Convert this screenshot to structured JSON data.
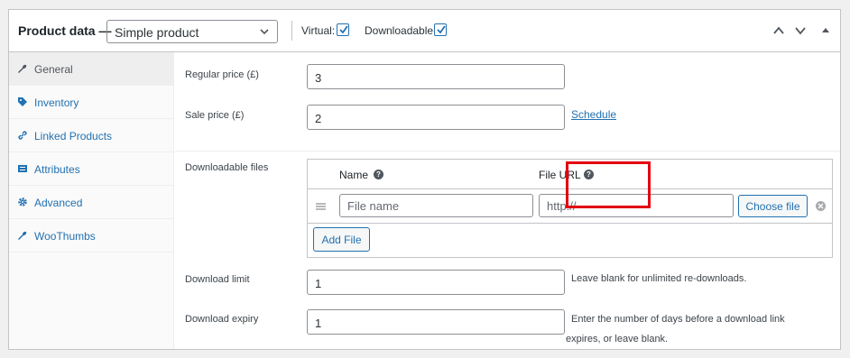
{
  "header": {
    "title": "Product data —",
    "product_type": "Simple product",
    "virtual_label": "Virtual:",
    "downloadable_label": "Downloadable:",
    "virtual_checked": true,
    "downloadable_checked": true
  },
  "tabs": [
    {
      "label": "General",
      "icon": "wrench-icon",
      "active": true
    },
    {
      "label": "Inventory",
      "icon": "tag-icon"
    },
    {
      "label": "Linked Products",
      "icon": "link-icon"
    },
    {
      "label": "Attributes",
      "icon": "list-icon"
    },
    {
      "label": "Advanced",
      "icon": "gear-icon"
    },
    {
      "label": "WooThumbs",
      "icon": "wrench-icon"
    }
  ],
  "general": {
    "regular_price_label": "Regular price (£)",
    "regular_price": "3",
    "sale_price_label": "Sale price (£)",
    "sale_price": "2",
    "schedule_link": "Schedule",
    "downloadable_files_label": "Downloadable files",
    "files_table": {
      "name_header": "Name",
      "url_header": "File URL",
      "rows": [
        {
          "name_placeholder": "File name",
          "url_placeholder": "http://",
          "choose_label": "Choose file"
        }
      ],
      "add_file_label": "Add File"
    },
    "download_limit_label": "Download limit",
    "download_limit": "1",
    "download_limit_desc": "Leave blank for unlimited re-downloads.",
    "download_expiry_label": "Download expiry",
    "download_expiry": "1",
    "download_expiry_desc_line1": "Enter the number of days before a download link",
    "download_expiry_desc_line2": "expires, or leave blank."
  },
  "colors": {
    "accent": "#2271b1",
    "highlight": "#e3000f"
  }
}
